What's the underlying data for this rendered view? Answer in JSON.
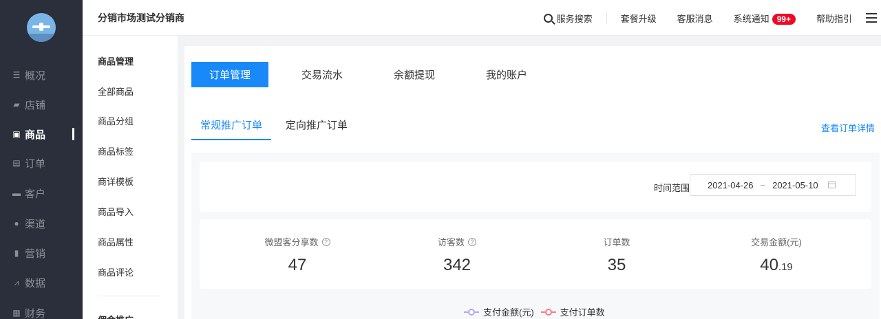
{
  "header": {
    "shop_name": "分销市场测试分销商",
    "search_label": "服务搜索",
    "links": [
      "套餐升级",
      "客服消息"
    ],
    "notice_label": "系统通知",
    "notice_badge": "99+",
    "help_label": "帮助指引"
  },
  "leftnav": {
    "items": [
      {
        "label": "概况",
        "icon": "list-icon"
      },
      {
        "label": "店铺",
        "icon": "store-icon"
      },
      {
        "label": "商品",
        "icon": "goods-icon",
        "active": true
      },
      {
        "label": "订单",
        "icon": "order-icon"
      },
      {
        "label": "客户",
        "icon": "vip-card-icon"
      },
      {
        "label": "渠道",
        "icon": "channel-icon"
      },
      {
        "label": "营销",
        "icon": "bar-chart-icon"
      },
      {
        "label": "数据",
        "icon": "line-chart-icon"
      },
      {
        "label": "财务",
        "icon": "calculator-icon"
      }
    ]
  },
  "subnav": {
    "section1_title": "商品管理",
    "items": [
      "全部商品",
      "商品分组",
      "商品标签",
      "商详模板",
      "商品导入",
      "商品属性",
      "商品评论"
    ],
    "section2_title": "佣金推广"
  },
  "main": {
    "tabs": [
      "订单管理",
      "交易流水",
      "余额提现",
      "我的账户"
    ],
    "subtabs": [
      "常规推广订单",
      "定向推广订单"
    ],
    "detail_link": "查看订单详情",
    "range_label": "时间范围",
    "range_start": "2021-04-26",
    "range_sep": "~",
    "range_end": "2021-05-10",
    "stats": [
      {
        "label": "微盟客分享数",
        "value": "47",
        "help": true
      },
      {
        "label": "访客数",
        "value": "342",
        "help": true
      },
      {
        "label": "订单数",
        "value": "35",
        "help": false
      },
      {
        "label": "交易金额(元)",
        "value": "40",
        "decimal": ".19",
        "help": false
      }
    ],
    "legend": [
      {
        "name": "支付金额(元)",
        "color": "#b4a7f0"
      },
      {
        "name": "支付订单数",
        "color": "#f57a8a"
      }
    ]
  },
  "colors": {
    "accent": "#1989fa",
    "nav_bg": "#2a2f3b",
    "badge": "#ee0a24"
  }
}
